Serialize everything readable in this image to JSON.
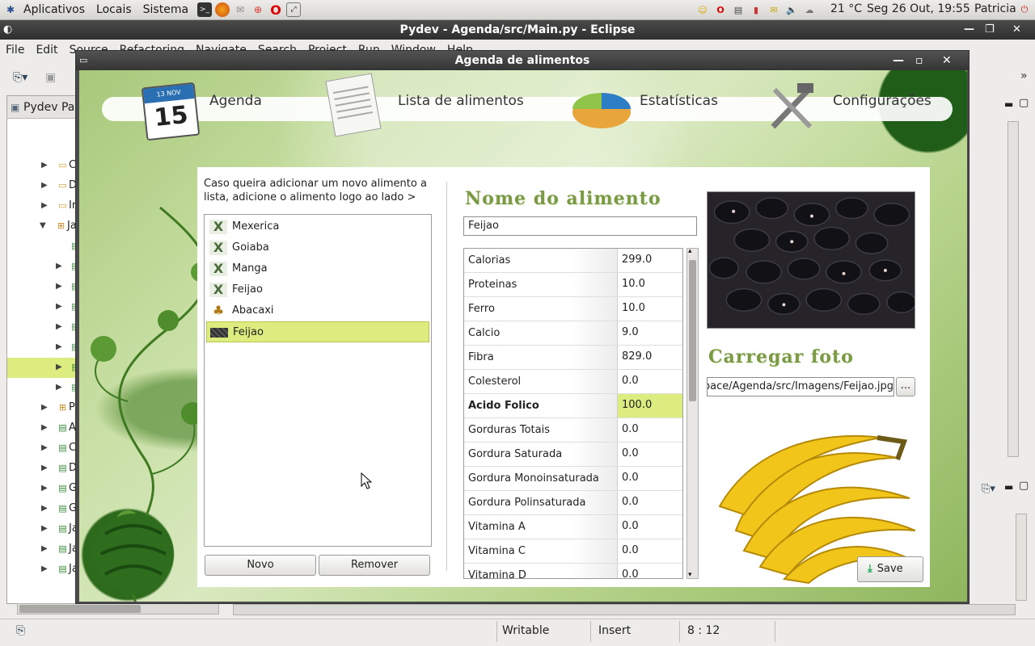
{
  "top_panel": {
    "menus": [
      "Aplicativos",
      "Locais",
      "Sistema"
    ],
    "weather": "21 °C",
    "clock": "Seg 26 Out, 19:55",
    "user": "Patricia"
  },
  "eclipse": {
    "title": "Pydev - Agenda/src/Main.py - Eclipse",
    "menus": [
      "File",
      "Edit",
      "Source",
      "Refactoring",
      "Navigate",
      "Search",
      "Project",
      "Run",
      "Window",
      "Help"
    ],
    "explorer_tab": "Pydev Pac",
    "tree": [
      {
        "label": "C",
        "type": "folder"
      },
      {
        "label": "D",
        "type": "folder"
      },
      {
        "label": "Ir",
        "type": "folder"
      },
      {
        "label": "Ja",
        "type": "package"
      },
      {
        "label": "P",
        "type": "package"
      },
      {
        "label": "A",
        "type": "file"
      },
      {
        "label": "C",
        "type": "file"
      },
      {
        "label": "D",
        "type": "file"
      },
      {
        "label": "G",
        "type": "file"
      },
      {
        "label": "G",
        "type": "file"
      },
      {
        "label": "Ja",
        "type": "file"
      },
      {
        "label": "Ja",
        "type": "file"
      },
      {
        "label": "Ja",
        "type": "file"
      }
    ],
    "status": {
      "writable": "Writable",
      "insert": "Insert",
      "position": "8 : 12"
    }
  },
  "dialog": {
    "title": "Agenda de alimentos",
    "nav": {
      "agenda": "Agenda",
      "calendar_month": "13 NOV",
      "calendar_day": "15",
      "foods": "Lista de alimentos",
      "stats": "Estatísticas",
      "settings": "Configurações"
    },
    "description": "Caso queira adicionar um novo alimento a lista, adicione o alimento logo ao lado >",
    "foods": [
      {
        "name": "Mexerica",
        "icon": "x-icon"
      },
      {
        "name": "Goiaba",
        "icon": "x-icon"
      },
      {
        "name": "Manga",
        "icon": "x-icon"
      },
      {
        "name": "Feijao",
        "icon": "x-icon"
      },
      {
        "name": "Abacaxi",
        "icon": "pineapple-icon"
      },
      {
        "name": "Feijao",
        "icon": "beans-thumb-icon",
        "selected": true
      }
    ],
    "buttons": {
      "new": "Novo",
      "remove": "Remover",
      "browse": "...",
      "save": "Save"
    },
    "name_heading": "Nome do alimento",
    "food_name": "Feijao",
    "nutrients": [
      {
        "name": "Calorias",
        "value": "299.0"
      },
      {
        "name": "Proteinas",
        "value": "10.0"
      },
      {
        "name": "Ferro",
        "value": "10.0"
      },
      {
        "name": "Calcio",
        "value": "9.0"
      },
      {
        "name": "Fibra",
        "value": "829.0"
      },
      {
        "name": "Colesterol",
        "value": "0.0"
      },
      {
        "name": "Acido Folico",
        "value": "100.0",
        "highlight": true
      },
      {
        "name": "Gorduras Totais",
        "value": "0.0"
      },
      {
        "name": "Gordura Saturada",
        "value": "0.0"
      },
      {
        "name": "Gordura Monoinsaturada",
        "value": "0.0"
      },
      {
        "name": "Gordura Polinsaturada",
        "value": "0.0"
      },
      {
        "name": "Vitamina A",
        "value": "0.0"
      },
      {
        "name": "Vitamina C",
        "value": "0.0"
      },
      {
        "name": "Vitamina D",
        "value": "0.0"
      }
    ],
    "photo_heading": "Carregar foto",
    "photo_path": "pace/Agenda/src/Imagens/Feijao.jpg"
  },
  "colors": {
    "accent_green": "#7a9a45",
    "selection": "#dcec7e",
    "title_bar": "#3a3a3a"
  }
}
